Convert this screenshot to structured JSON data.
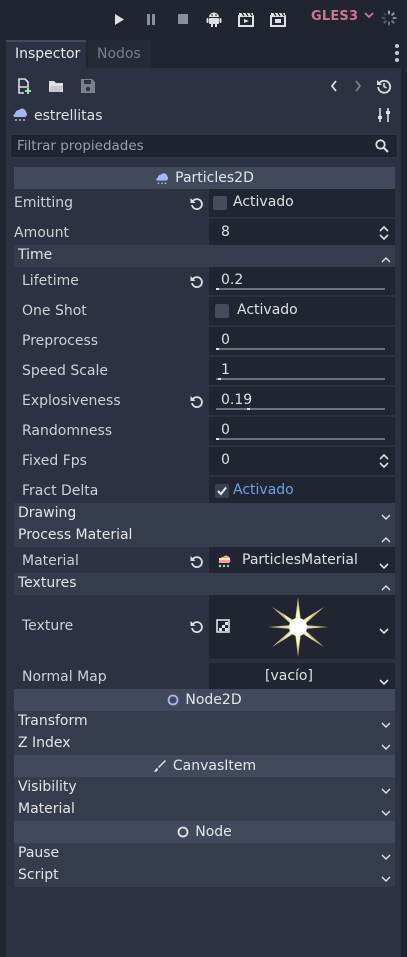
{
  "toolbar": {
    "icons": [
      "play-icon",
      "pause-icon",
      "stop-icon",
      "android-icon",
      "movie-clapper-icon",
      "movie-clapper-alt-icon",
      "spinner-icon"
    ],
    "renderer": "GLES3"
  },
  "tabs": [
    {
      "label": "Inspector",
      "active": true
    },
    {
      "label": "Nodos",
      "active": false
    }
  ],
  "node": {
    "name": "estrellitas",
    "icon": "particles-icon"
  },
  "filter": {
    "placeholder": "Filtrar propiedades"
  },
  "sections": {
    "particles2d": "Particles2D",
    "node2d": "Node2D",
    "canvasitem": "CanvasItem",
    "node": "Node"
  },
  "props": {
    "emitting": {
      "label": "Emitting",
      "check": "Activado"
    },
    "amount": {
      "label": "Amount",
      "value": "8"
    },
    "time_group": "Time",
    "lifetime": {
      "label": "Lifetime",
      "value": "0.2"
    },
    "one_shot": {
      "label": "One Shot",
      "check": "Activado"
    },
    "preprocess": {
      "label": "Preprocess",
      "value": "0"
    },
    "speed_scale": {
      "label": "Speed Scale",
      "value": "1"
    },
    "explosiveness": {
      "label": "Explosiveness",
      "value": "0.19"
    },
    "randomness": {
      "label": "Randomness",
      "value": "0"
    },
    "fixed_fps": {
      "label": "Fixed Fps",
      "value": "0"
    },
    "fract_delta": {
      "label": "Fract Delta",
      "check": "Activado"
    },
    "drawing_group": "Drawing",
    "process_material_group": "Process Material",
    "material": {
      "label": "Material",
      "value": "ParticlesMaterial"
    },
    "textures_group": "Textures",
    "texture": {
      "label": "Texture"
    },
    "normal_map": {
      "label": "Normal Map",
      "value": "[vacío]"
    }
  },
  "groups_lower": {
    "transform": "Transform",
    "z_index": "Z Index",
    "visibility": "Visibility",
    "material": "Material",
    "pause": "Pause",
    "script": "Script"
  },
  "colors": {
    "background": "#202531",
    "panel": "#2c3241",
    "section": "#404a5c",
    "group": "#353d4d",
    "accent": "#6ba3e8",
    "renderer": "#d47391"
  }
}
